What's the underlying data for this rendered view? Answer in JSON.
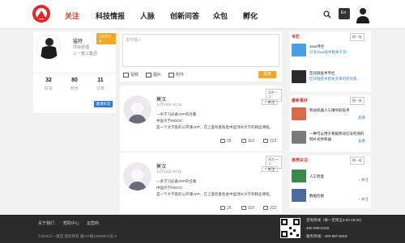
{
  "header": {
    "nav": [
      {
        "label": "关注",
        "active": true
      },
      {
        "label": "科技情报",
        "active": false
      },
      {
        "label": "人脉",
        "active": false
      },
      {
        "label": "创新问答",
        "active": false
      },
      {
        "label": "众包",
        "active": false
      },
      {
        "label": "孵化",
        "active": false
      }
    ],
    "message_icon_label": "En"
  },
  "profile": {
    "badge": "已实名认证",
    "name": "猛特",
    "role": "项目经理",
    "company": "三一重工集团",
    "stats": [
      {
        "value": "32",
        "label": "好友"
      },
      {
        "value": "80",
        "label": "粉丝"
      },
      {
        "value": "11",
        "label": "订单"
      }
    ],
    "invite_button": "邀请好友"
  },
  "composer": {
    "placeholder": "发布输入",
    "tools": [
      "视频",
      "图片",
      "附件"
    ],
    "publish_button": "发布"
  },
  "posts": [
    {
      "name": "莫汉",
      "time": "11月18日 00:16",
      "tag": "同步一下",
      "follow": "+ 关注",
      "lines": [
        "一条学习必备APP的合集",
        "中国大学MOOC:",
        "是一个大学类的公开课APP，在上面有着各类中国顶尖大学的精品课程。"
      ],
      "shares": "25",
      "comments": "110",
      "likes": "222"
    },
    {
      "name": "莫汉",
      "time": "11月18日 00:16",
      "tag": "同步一下",
      "follow": "+ 关注",
      "lines": [
        "一条学习必备APP的合集",
        "中国大学MOOC:",
        "是一个大学类的公开课APP，在上面有着各类中国顶尖大学的精品课程。"
      ],
      "shares": "25",
      "comments": "110",
      "likes": "222"
    }
  ],
  "sidebar": {
    "column_head": "专栏",
    "column_tag": "换一批",
    "columns": [
      {
        "title": "Java专栏",
        "desc": "分享Java技术相关干货!",
        "color": "#4aa0e6"
      },
      {
        "title": "区块链技术专栏",
        "desc": "区块链技术相关文章的原创基…",
        "color": "#2b2b2b"
      }
    ],
    "news_head": "最新看好",
    "news_tag": "换一批",
    "news": [
      {
        "title": "移动机器人三维导航技术",
        "link": "查看",
        "color": "#d86b4a"
      },
      {
        "title": "一种可以用于救援移动信号检测的",
        "desc": "制片式件移器",
        "link": "查看",
        "color": "#7a7a7a"
      }
    ],
    "recommend_head": "推荐关注",
    "recommend_tag": "换一批",
    "recommend": [
      {
        "title": "人工智能",
        "link": "+ 关注",
        "color": "#3c8a4a"
      },
      {
        "title": "数据挖掘",
        "link": "+ 关注",
        "color": "#4a6aa0"
      }
    ]
  },
  "footer": {
    "links": [
      "关于我们",
      "帮助中心",
      "运营商"
    ],
    "copyright": "©2018三一集团 版权所有 湘ICP备10005672号-3",
    "hotline_label": "咨询热线（每一至周五9:00-18:00）",
    "hotline": "400-999-5318",
    "service_label": "服务热线：400-887-8318"
  }
}
